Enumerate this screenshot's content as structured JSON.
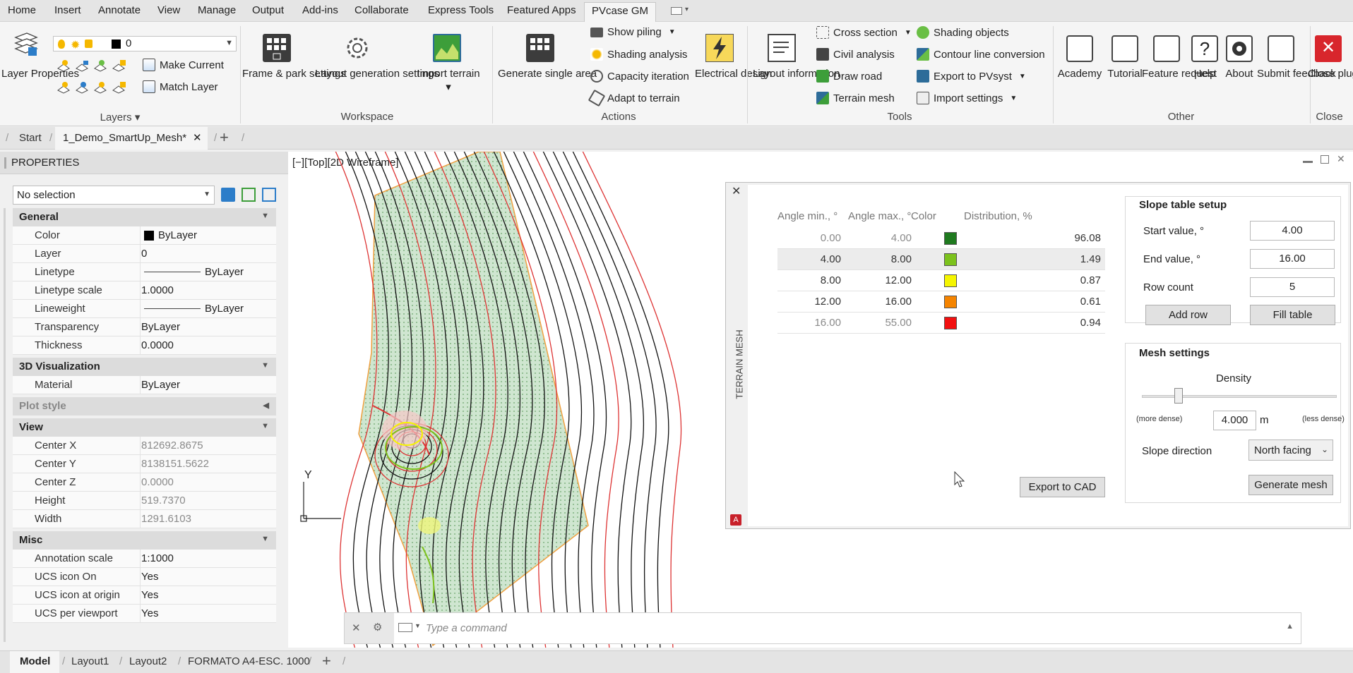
{
  "menu": {
    "items": [
      "Home",
      "Insert",
      "Annotate",
      "View",
      "Manage",
      "Output",
      "Add-ins",
      "Collaborate",
      "Express Tools",
      "Featured Apps",
      "PVcase GM"
    ]
  },
  "ribbon": {
    "layers": {
      "layer_properties": "Layer Properties",
      "layer_value": "0",
      "make_current": "Make Current",
      "match_layer": "Match Layer",
      "group_title": "Layers"
    },
    "workspace": {
      "frame_park": "Frame & park settings",
      "layout_gen": "Layout generation settings",
      "import_terrain": "Import terrain",
      "group_title": "Workspace"
    },
    "actions": {
      "generate_single": "Generate single area",
      "show_piling": "Show piling",
      "shading_analysis": "Shading analysis",
      "capacity_iteration": "Capacity iteration",
      "adapt_terrain": "Adapt to terrain",
      "electrical_design": "Electrical design",
      "group_title": "Actions"
    },
    "tools": {
      "layout_information": "Layout information",
      "cross_section": "Cross section",
      "civil_analysis": "Civil analysis",
      "draw_road": "Draw road",
      "terrain_mesh": "Terrain mesh",
      "shading_objects": "Shading objects",
      "contour_line_conversion": "Contour line conversion",
      "export_pvsyst": "Export to PVsyst",
      "import_settings": "Import settings",
      "group_title": "Tools"
    },
    "other": {
      "academy": "Academy",
      "tutorial": "Tutorial",
      "feature_request": "Feature request",
      "help": "Help",
      "about": "About",
      "submit_feedback": "Submit feedback",
      "group_title": "Other"
    },
    "close": {
      "close_plugin": "Close plugin",
      "group_title": "Close"
    }
  },
  "file_tabs": {
    "start": "Start",
    "active": "1_Demo_SmartUp_Mesh*"
  },
  "properties": {
    "title": "PROPERTIES",
    "selection": "No selection",
    "sections": {
      "general": "General",
      "viz3d": "3D Visualization",
      "plot_style": "Plot style",
      "view": "View",
      "misc": "Misc"
    },
    "general": [
      {
        "k": "Color",
        "v": "ByLayer"
      },
      {
        "k": "Layer",
        "v": "0"
      },
      {
        "k": "Linetype",
        "v": "ByLayer"
      },
      {
        "k": "Linetype scale",
        "v": "1.0000"
      },
      {
        "k": "Lineweight",
        "v": "ByLayer"
      },
      {
        "k": "Transparency",
        "v": "ByLayer"
      },
      {
        "k": "Thickness",
        "v": "0.0000"
      }
    ],
    "viz3d": [
      {
        "k": "Material",
        "v": "ByLayer"
      }
    ],
    "view": [
      {
        "k": "Center X",
        "v": "812692.8675"
      },
      {
        "k": "Center Y",
        "v": "8138151.5622"
      },
      {
        "k": "Center Z",
        "v": "0.0000"
      },
      {
        "k": "Height",
        "v": "519.7370"
      },
      {
        "k": "Width",
        "v": "1291.6103"
      }
    ],
    "misc": [
      {
        "k": "Annotation scale",
        "v": "1:1000"
      },
      {
        "k": "UCS icon On",
        "v": "Yes"
      },
      {
        "k": "UCS icon at origin",
        "v": "Yes"
      },
      {
        "k": "UCS per viewport",
        "v": "Yes"
      }
    ]
  },
  "viewport": {
    "label": "[−][Top][2D Wireframe]",
    "axis_y": "Y"
  },
  "terrain_mesh": {
    "side_title": "TERRAIN MESH",
    "columns": [
      "Angle min., °",
      "Angle max., °",
      "Color",
      "Distribution, %"
    ],
    "rows": [
      {
        "min": "0.00",
        "max": "4.00",
        "color": "#1f7a1f",
        "dist": "96.08"
      },
      {
        "min": "4.00",
        "max": "8.00",
        "color": "#7cc21c",
        "dist": "1.49"
      },
      {
        "min": "8.00",
        "max": "12.00",
        "color": "#f5f500",
        "dist": "0.87"
      },
      {
        "min": "12.00",
        "max": "16.00",
        "color": "#f58400",
        "dist": "0.61"
      },
      {
        "min": "16.00",
        "max": "55.00",
        "color": "#f21010",
        "dist": "0.94"
      }
    ],
    "export_to_cad": "Export to CAD",
    "slope_setup": {
      "title": "Slope table setup",
      "start_label": "Start value, °",
      "start_value": "4.00",
      "end_label": "End value, °",
      "end_value": "16.00",
      "row_count_label": "Row count",
      "row_count_value": "5",
      "add_row": "Add row",
      "fill_table": "Fill table"
    },
    "mesh_settings": {
      "title": "Mesh settings",
      "density_label": "Density",
      "more_dense": "(more dense)",
      "less_dense": "(less dense)",
      "density_value": "4.000",
      "unit": "m",
      "slope_direction_label": "Slope direction",
      "slope_direction_value": "North facing",
      "generate_mesh": "Generate mesh",
      "density_level": 0.19
    }
  },
  "command": {
    "placeholder": "Type a command"
  },
  "bottom_tabs": [
    "Model",
    "Layout1",
    "Layout2",
    "FORMATO A4-ESC. 1000"
  ]
}
